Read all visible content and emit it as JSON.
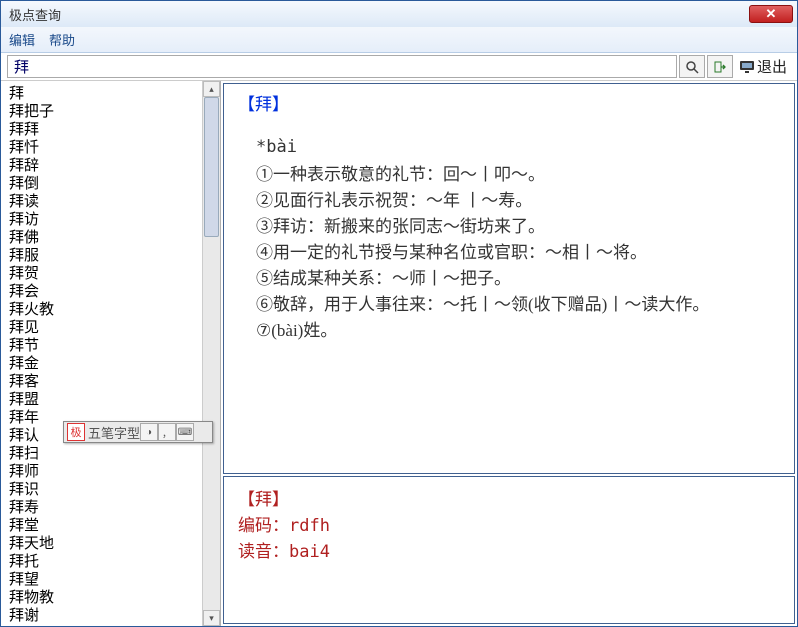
{
  "window": {
    "title": "极点查询"
  },
  "menu": {
    "edit": "编辑",
    "help": "帮助"
  },
  "search": {
    "value": "拜",
    "placeholder": ""
  },
  "toolbar": {
    "exit": "退出"
  },
  "sidebar": {
    "items": [
      "拜",
      "拜把子",
      "拜拜",
      "拜忏",
      "拜辞",
      "拜倒",
      "拜读",
      "拜访",
      "拜佛",
      "拜服",
      "拜贺",
      "拜会",
      "拜火教",
      "拜见",
      "拜节",
      "拜金",
      "拜客",
      "拜盟",
      "拜年",
      "拜认",
      "拜扫",
      "拜师",
      "拜识",
      "拜寿",
      "拜堂",
      "拜天地",
      "拜托",
      "拜望",
      "拜物教",
      "拜谢"
    ]
  },
  "ime": {
    "label": "五笔字型"
  },
  "definition": {
    "head": "【拜】",
    "pinyin": "*bài",
    "lines": [
      "①一种表示敬意的礼节：回～丨叩～。",
      "②见面行礼表示祝贺：～年 丨～寿。",
      "③拜访：新搬来的张同志～街坊来了。",
      "④用一定的礼节授与某种名位或官职：～相丨～将。",
      "⑤结成某种关系：～师丨～把子。",
      "⑥敬辞，用于人事往来：～托丨～领(收下赠品)丨～读大作。",
      "⑦(bài)姓。"
    ]
  },
  "info": {
    "head": "【拜】",
    "code_label": "编码：",
    "code_value": "rdfh",
    "pron_label": "读音：",
    "pron_value": "bai4"
  }
}
